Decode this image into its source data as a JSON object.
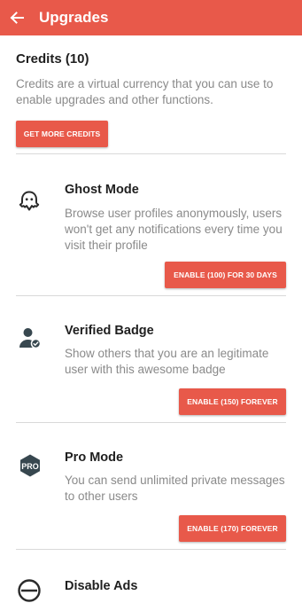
{
  "appbar": {
    "title": "Upgrades",
    "back_icon": "arrow-left-icon",
    "color": "#e8594a"
  },
  "credits": {
    "title": "Credits (10)",
    "description": "Credits are a virtual currency that you can use to enable upgrades and other functions.",
    "button": "GET MORE CREDITS"
  },
  "upgrades": [
    {
      "icon": "ghost-icon",
      "title": "Ghost Mode",
      "description": "Browse user profiles anonymously, users won't get any notifications every time you visit their profile",
      "button": "ENABLE (100) FOR 30 DAYS"
    },
    {
      "icon": "verified-user-icon",
      "title": "Verified Badge",
      "description": "Show others that you are an legitimate user with this awesome badge",
      "button": "ENABLE (150) FOREVER"
    },
    {
      "icon": "pro-badge-icon",
      "icon_text": "PRO",
      "title": "Pro Mode",
      "description": "You can send unlimited private messages to other users",
      "button": "ENABLE (170) FOREVER"
    },
    {
      "icon": "block-icon",
      "title": "Disable Ads"
    }
  ]
}
